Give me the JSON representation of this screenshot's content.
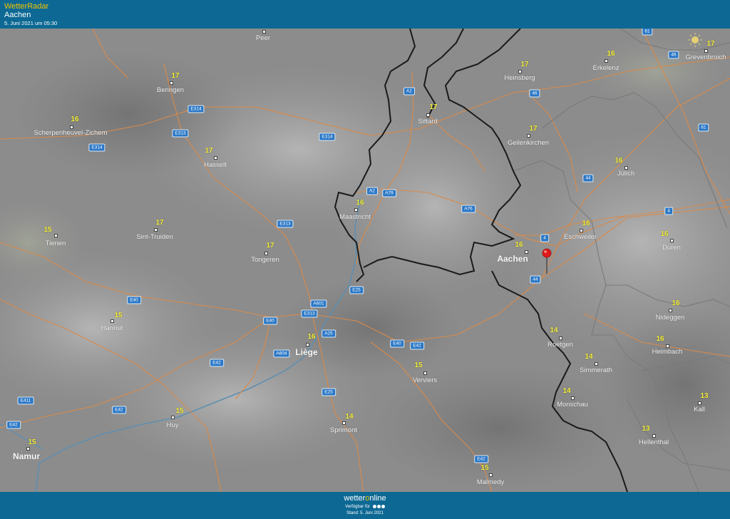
{
  "header": {
    "brand": "WetterRadar",
    "location": "Aachen",
    "timestamp": "5. Juni 2021 um 05:30"
  },
  "footer": {
    "logo_a": "wetter",
    "logo_b": "o",
    "logo_c": "nline",
    "availability": "Verfügbar für",
    "status": "Stand: 5. Juni 2021"
  },
  "colors": {
    "header_bg": "#0d6994",
    "temperature": "#f5ef3a",
    "road": "#d98a4a",
    "border": "#1a1a1a",
    "river": "#5f8fb0",
    "shield": "#2b78c7",
    "pin": "#e01b1b"
  },
  "cities": [
    {
      "name": "Peer",
      "temp": ""
    },
    {
      "name": "Beringen",
      "temp": "17"
    },
    {
      "name": "Scherpenheuvel-Zichem",
      "temp": "16"
    },
    {
      "name": "Hasselt",
      "temp": "17"
    },
    {
      "name": "Tienen",
      "temp": "15"
    },
    {
      "name": "Sint-Truiden",
      "temp": "17"
    },
    {
      "name": "Tongeren",
      "temp": "17"
    },
    {
      "name": "Hannut",
      "temp": "15"
    },
    {
      "name": "Huy",
      "temp": "15"
    },
    {
      "name": "Namur",
      "temp": "15"
    },
    {
      "name": "Liège",
      "temp": "16"
    },
    {
      "name": "Sprimont",
      "temp": "14"
    },
    {
      "name": "Verviers",
      "temp": "15"
    },
    {
      "name": "Malmedy",
      "temp": "15"
    },
    {
      "name": "Maastricht",
      "temp": "16"
    },
    {
      "name": "Sittard",
      "temp": "17"
    },
    {
      "name": "Heinsberg",
      "temp": "17"
    },
    {
      "name": "Erkelenz",
      "temp": "16"
    },
    {
      "name": "Grevenbroich",
      "temp": "17"
    },
    {
      "name": "Geilenkirchen",
      "temp": "17"
    },
    {
      "name": "Jülich",
      "temp": "16"
    },
    {
      "name": "Eschweiler",
      "temp": "16"
    },
    {
      "name": "Aachen",
      "temp": "16"
    },
    {
      "name": "Düren",
      "temp": "16"
    },
    {
      "name": "Roetgen",
      "temp": "14"
    },
    {
      "name": "Simmerath",
      "temp": "14"
    },
    {
      "name": "Monschau",
      "temp": "14"
    },
    {
      "name": "Nideggen",
      "temp": "16"
    },
    {
      "name": "Heimbach",
      "temp": "16"
    },
    {
      "name": "Kall",
      "temp": "13"
    },
    {
      "name": "Hellenthal",
      "temp": "13"
    }
  ],
  "roads": [
    "E314",
    "E314",
    "E313",
    "E314",
    "E313",
    "E40",
    "E40",
    "A601",
    "E313",
    "E25",
    "A25",
    "E40",
    "E42",
    "A604",
    "E42",
    "E42",
    "E411",
    "E42",
    "E25",
    "E42",
    "A2",
    "A2",
    "A79",
    "A76",
    "4",
    "44",
    "44",
    "46",
    "61",
    "46",
    "61",
    "4"
  ]
}
